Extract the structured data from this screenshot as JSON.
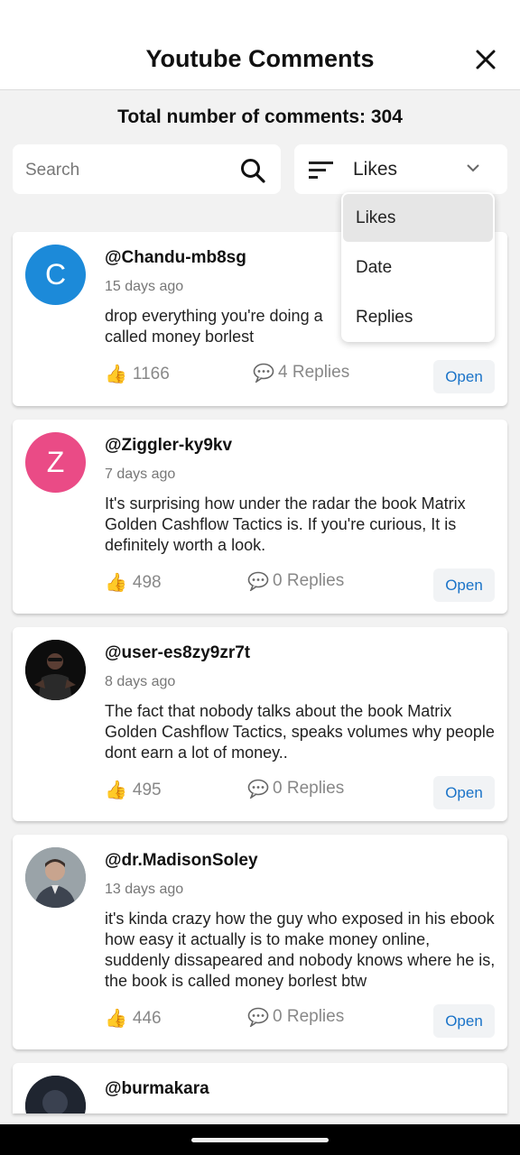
{
  "header": {
    "title": "Youtube Comments"
  },
  "total_label": "Total number of comments: 304",
  "search": {
    "placeholder": "Search"
  },
  "sort": {
    "selected": "Likes",
    "options": [
      "Likes",
      "Date",
      "Replies"
    ]
  },
  "comments": [
    {
      "avatar_letter": "C",
      "avatar_color": "#1c8ad9",
      "username": "@Chandu-mb8sg",
      "time": "15 days ago",
      "text": "drop everything you're doing a\ncalled money borlest",
      "likes": "1166",
      "replies": "4 Replies",
      "open_label": "Open"
    },
    {
      "avatar_letter": "Z",
      "avatar_color": "#ea4b86",
      "username": "@Ziggler-ky9kv",
      "time": "7 days ago",
      "text": "It's surprising how under the radar the book Matrix Golden Cashflow Tactics is. If you're curious, It is  definitely worth a look.",
      "likes": "498",
      "replies": "0 Replies",
      "open_label": "Open"
    },
    {
      "username": "@user-es8zy9zr7t",
      "time": "8 days ago",
      "text": "The fact that nobody talks about the book Matrix Golden Cashflow Tactics, speaks volumes why people dont earn a lot of money..",
      "likes": "495",
      "replies": "0 Replies",
      "open_label": "Open"
    },
    {
      "username": "@dr.MadisonSoley",
      "time": "13 days ago",
      "text": "it's kinda crazy how the guy who exposed in his ebook how easy it actually is to make money online, suddenly dissapeared and nobody knows where he is, the book is called money borlest btw",
      "likes": "446",
      "replies": "0 Replies",
      "open_label": "Open"
    },
    {
      "username": "@burmakara"
    }
  ]
}
